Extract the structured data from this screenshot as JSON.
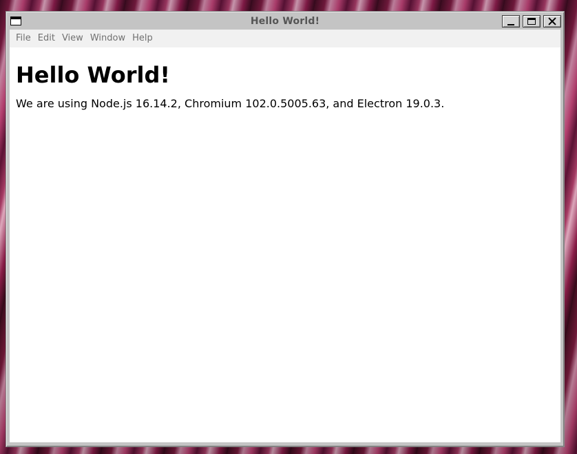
{
  "window": {
    "title": "Hello World!"
  },
  "menubar": {
    "items": [
      {
        "label": "File"
      },
      {
        "label": "Edit"
      },
      {
        "label": "View"
      },
      {
        "label": "Window"
      },
      {
        "label": "Help"
      }
    ]
  },
  "content": {
    "heading": "Hello World!",
    "versions_text": "We are using Node.js 16.14.2, Chromium 102.0.5005.63, and Electron 19.0.3."
  },
  "icons": {
    "window_menu": "window-menu-icon",
    "minimize": "minimize-icon",
    "maximize": "maximize-icon",
    "close": "close-icon"
  },
  "colors": {
    "titlebar_bg": "#c4c4c4",
    "title_text": "#555555",
    "menubar_bg": "#f1f1f1",
    "menu_text": "#707070",
    "content_bg": "#ffffff"
  }
}
